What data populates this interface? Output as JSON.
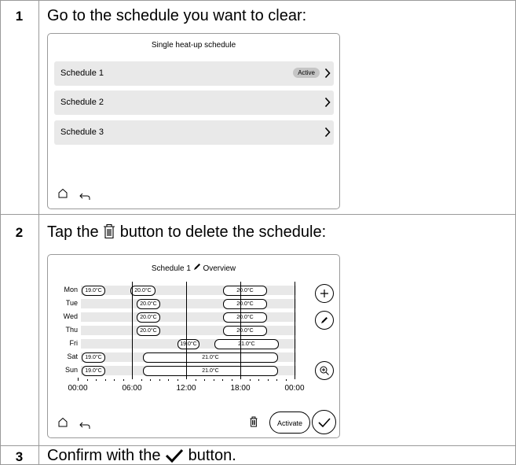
{
  "steps": [
    {
      "num": "1",
      "before": "Go to the schedule you want to clear:"
    },
    {
      "num": "2",
      "before": "Tap the ",
      "after": " button to delete the schedule:"
    },
    {
      "num": "3",
      "before": "Confirm with the ",
      "after": " button."
    }
  ],
  "screen1": {
    "title": "Single heat-up schedule",
    "rows": [
      {
        "label": "Schedule 1",
        "badge": "Active"
      },
      {
        "label": "Schedule 2"
      },
      {
        "label": "Schedule 3"
      }
    ]
  },
  "screen2": {
    "title": "Schedule 1",
    "title_suffix": "Overview",
    "days": [
      {
        "day": "Mon",
        "blocks": [
          "19.0°C",
          "20.0°C",
          "20.0°C"
        ]
      },
      {
        "day": "Tue",
        "blocks": [
          "20.0°C",
          "20.0°C"
        ]
      },
      {
        "day": "Wed",
        "blocks": [
          "20.0°C",
          "20.0°C"
        ]
      },
      {
        "day": "Thu",
        "blocks": [
          "20.0°C",
          "20.0°C"
        ]
      },
      {
        "day": "Fri",
        "blocks": [
          "19.0°C",
          "21.0°C"
        ]
      },
      {
        "day": "Sat",
        "blocks": [
          "19.0°C",
          "21.0°C"
        ]
      },
      {
        "day": "Sun",
        "blocks": [
          "19.0°C",
          "21.0°C"
        ]
      }
    ],
    "time_ticks": [
      "00:00",
      "06:00",
      "12:00",
      "18:00",
      "00:00"
    ],
    "activate_label": "Activate"
  },
  "icons": {
    "home": "home-icon",
    "back": "back-arrow-icon",
    "chevron": "chevron-right-icon",
    "trash": "trash-icon",
    "check": "check-icon",
    "plus": "plus-icon",
    "pencil": "pencil-icon",
    "zoom": "zoom-in-icon"
  }
}
